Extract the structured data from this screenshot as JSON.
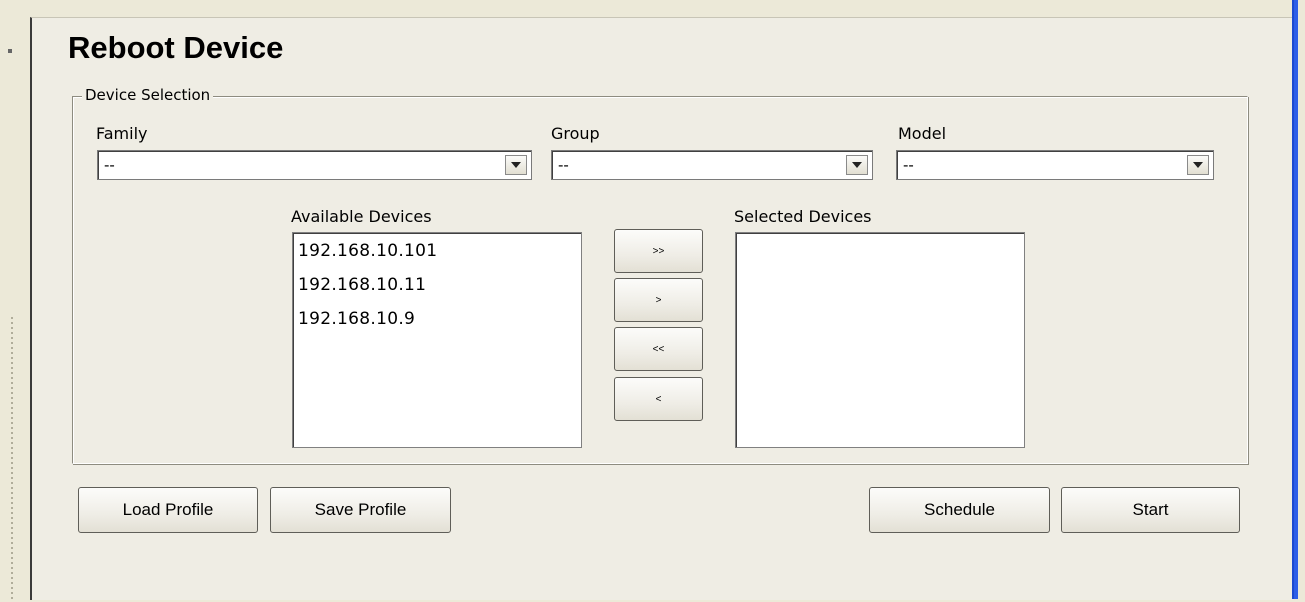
{
  "title": "Reboot Device",
  "device_selection": {
    "legend": "Device Selection",
    "family": {
      "label": "Family",
      "value": "--"
    },
    "group": {
      "label": "Group",
      "value": "--"
    },
    "model": {
      "label": "Model",
      "value": "--"
    }
  },
  "available_devices": {
    "label": "Available Devices",
    "items": [
      "192.168.10.101",
      "192.168.10.11",
      "192.168.10.9"
    ]
  },
  "selected_devices": {
    "label": "Selected Devices",
    "items": []
  },
  "transfer_buttons": {
    "add_all": ">>",
    "add_one": ">",
    "remove_all": "<<",
    "remove_one": "<"
  },
  "actions": {
    "load_profile": "Load Profile",
    "save_profile": "Save Profile",
    "schedule": "Schedule",
    "start": "Start"
  },
  "colors": {
    "panel_bg": "#efede4",
    "window_accent": "#1c4ad0"
  }
}
